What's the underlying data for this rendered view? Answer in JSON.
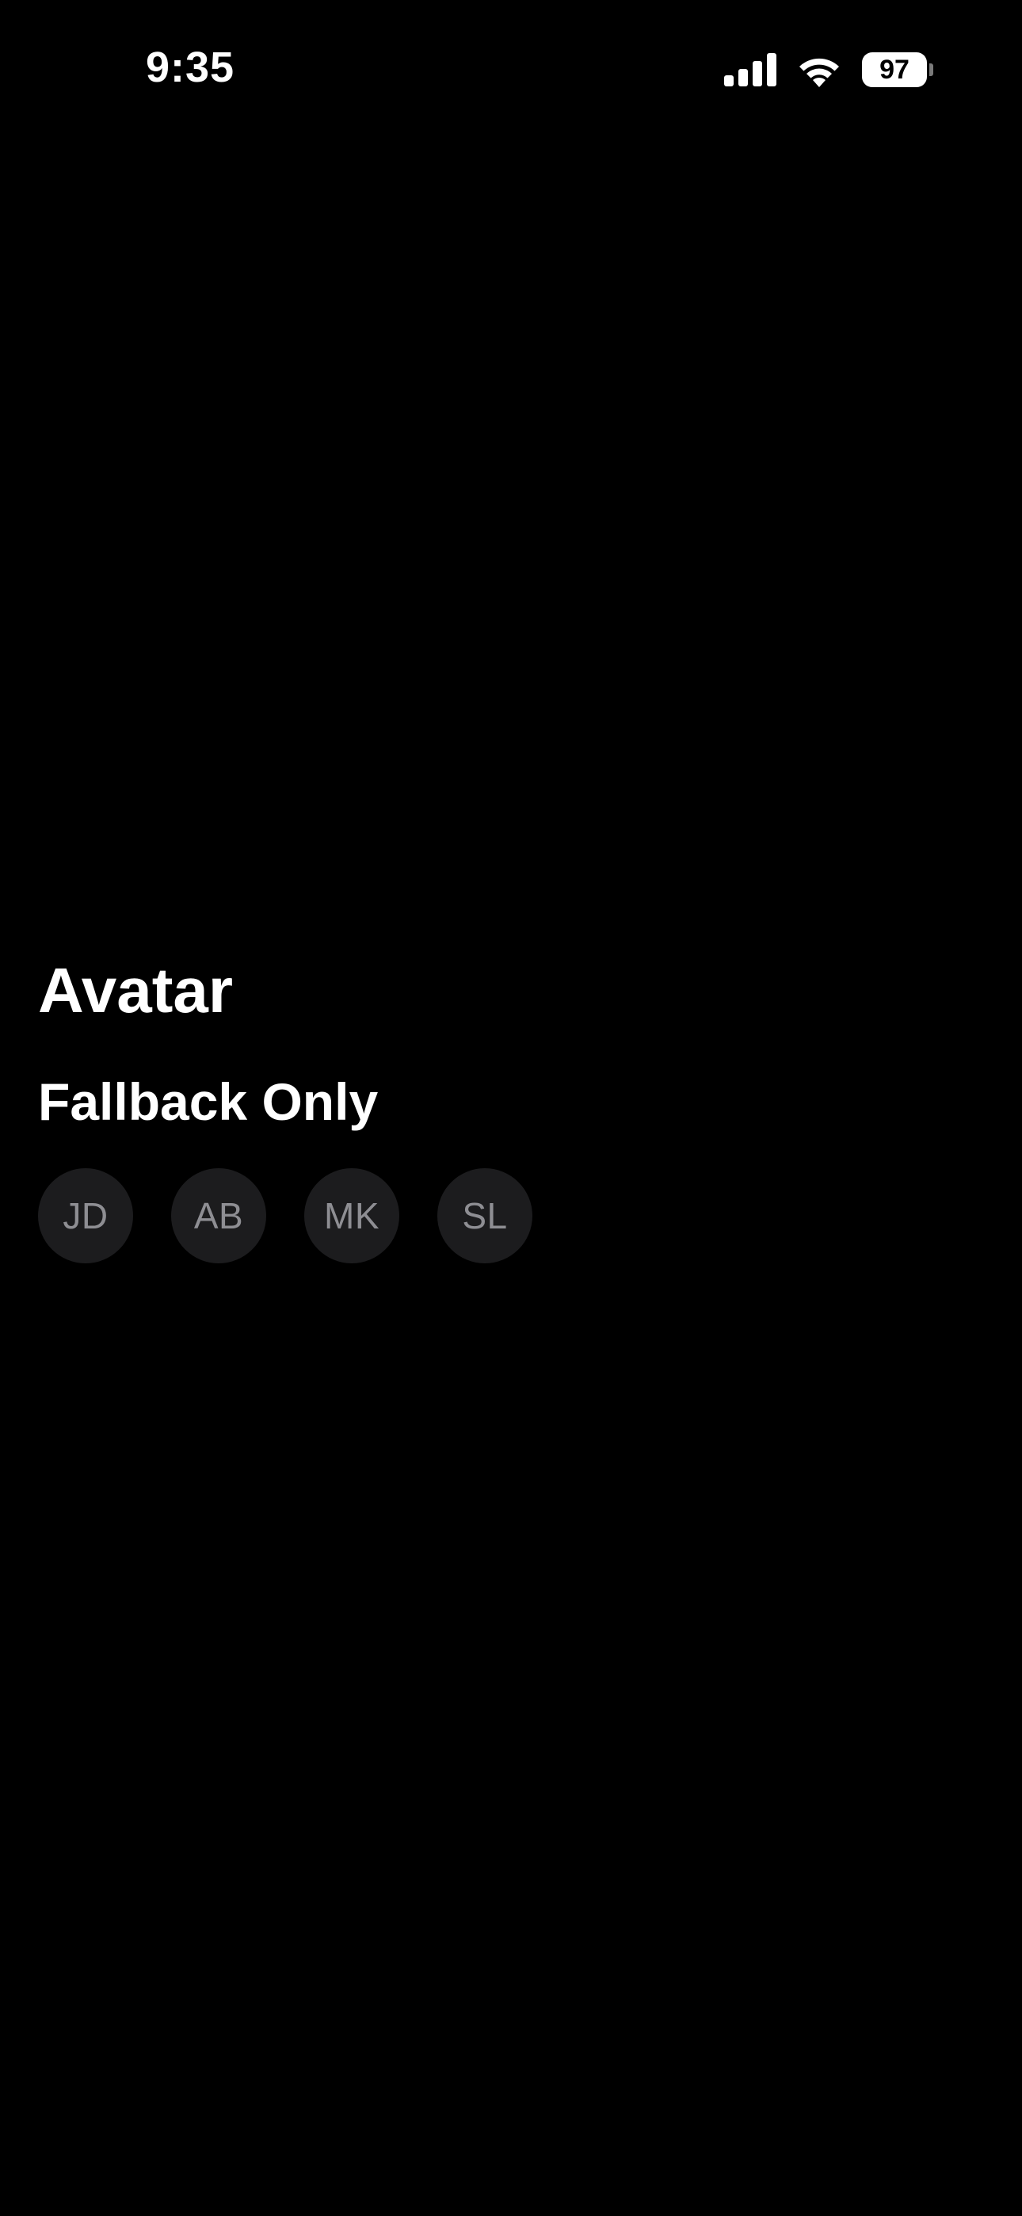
{
  "status_bar": {
    "time": "9:35",
    "battery_level": "97",
    "icons": [
      "signal-icon",
      "wifi-icon",
      "battery-icon"
    ]
  },
  "page": {
    "title": "Avatar",
    "section_title": "Fallback Only"
  },
  "avatars": [
    {
      "initials": "JD"
    },
    {
      "initials": "AB"
    },
    {
      "initials": "MK"
    },
    {
      "initials": "SL"
    }
  ],
  "colors": {
    "background": "#000000",
    "text": "#ffffff",
    "avatar_background": "#1c1c1e",
    "avatar_text": "#8e8e93"
  }
}
